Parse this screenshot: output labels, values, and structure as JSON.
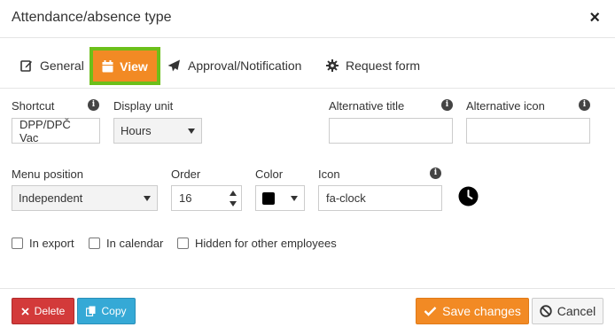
{
  "dialog": {
    "title": "Attendance/absence type",
    "close_glyph": "×"
  },
  "tabs": [
    {
      "label": "General",
      "icon": "edit-icon"
    },
    {
      "label": "View",
      "icon": "calendar-icon",
      "active": true
    },
    {
      "label": "Approval/Notification",
      "icon": "paper-plane-icon"
    },
    {
      "label": "Request form",
      "icon": "gear-icon"
    }
  ],
  "form": {
    "shortcut": {
      "label": "Shortcut",
      "value": "DPP/DPČ Vac"
    },
    "display_unit": {
      "label": "Display unit",
      "value": "Hours"
    },
    "alternative_title": {
      "label": "Alternative title",
      "value": ""
    },
    "alternative_icon": {
      "label": "Alternative icon",
      "value": ""
    },
    "menu_position": {
      "label": "Menu position",
      "value": "Independent"
    },
    "order": {
      "label": "Order",
      "value": "16"
    },
    "color": {
      "label": "Color",
      "value": "#000000"
    },
    "icon": {
      "label": "Icon",
      "value": "fa-clock",
      "preview_icon": "clock-icon"
    }
  },
  "checkboxes": [
    {
      "label": "In export",
      "checked": false
    },
    {
      "label": "In calendar",
      "checked": false
    },
    {
      "label": "Hidden for other employees",
      "checked": false
    }
  ],
  "footer": {
    "delete_label": "Delete",
    "copy_label": "Copy",
    "save_label": "Save changes",
    "cancel_label": "Cancel"
  },
  "colors": {
    "accent_orange": "#f28a24",
    "active_tab_border": "#6cbf1a",
    "delete_red": "#d33a3a",
    "copy_blue": "#35a9d6"
  }
}
